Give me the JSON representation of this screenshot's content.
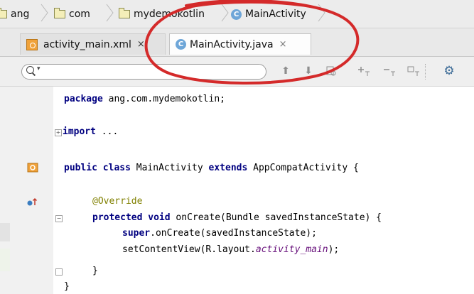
{
  "breadcrumb": {
    "items": [
      {
        "label": "ang",
        "icon": "folder-icon"
      },
      {
        "label": "com",
        "icon": "folder-icon"
      },
      {
        "label": "mydemokotlin",
        "icon": "folder-icon"
      },
      {
        "label": "MainActivity",
        "icon": "class-icon"
      }
    ]
  },
  "tabs": [
    {
      "label": "activity_main.xml",
      "icon": "xml-layout-icon",
      "close": "×",
      "active": false
    },
    {
      "label": "MainActivity.java",
      "icon": "class-icon",
      "close": "×",
      "active": true
    }
  ],
  "search": {
    "value": "",
    "caret": "▾"
  },
  "toolbar_icons": [
    "arrow-up-icon",
    "arrow-down-icon",
    "find-usages-icon",
    "add-occurrence-icon",
    "remove-occurrence-icon",
    "select-all-occurrences-icon",
    "settings-gear-icon"
  ],
  "code": {
    "package_kw": "package",
    "package_name": " ang.com.mydemokotlin;",
    "import_kw": "import",
    "import_rest": " ...",
    "class_kw1": "public",
    "class_kw2": "class",
    "class_name": " MainActivity ",
    "class_kw3": "extends",
    "class_parent": " AppCompatActivity {",
    "annotation": "@Override",
    "method_kw1": "protected",
    "method_kw2": "void",
    "method_rest": " onCreate(Bundle savedInstanceState) {",
    "super_kw": "super",
    "super_rest": ".onCreate(savedInstanceState);",
    "setcontent_start": "setContentView(R.layout.",
    "setcontent_field": "activity_main",
    "setcontent_end": ");",
    "close_method": "}",
    "close_class": "}"
  },
  "colors": {
    "annotation_ring": "#d42a2a",
    "keyword": "#000080",
    "field": "#660e7a",
    "annotation": "#808000"
  }
}
